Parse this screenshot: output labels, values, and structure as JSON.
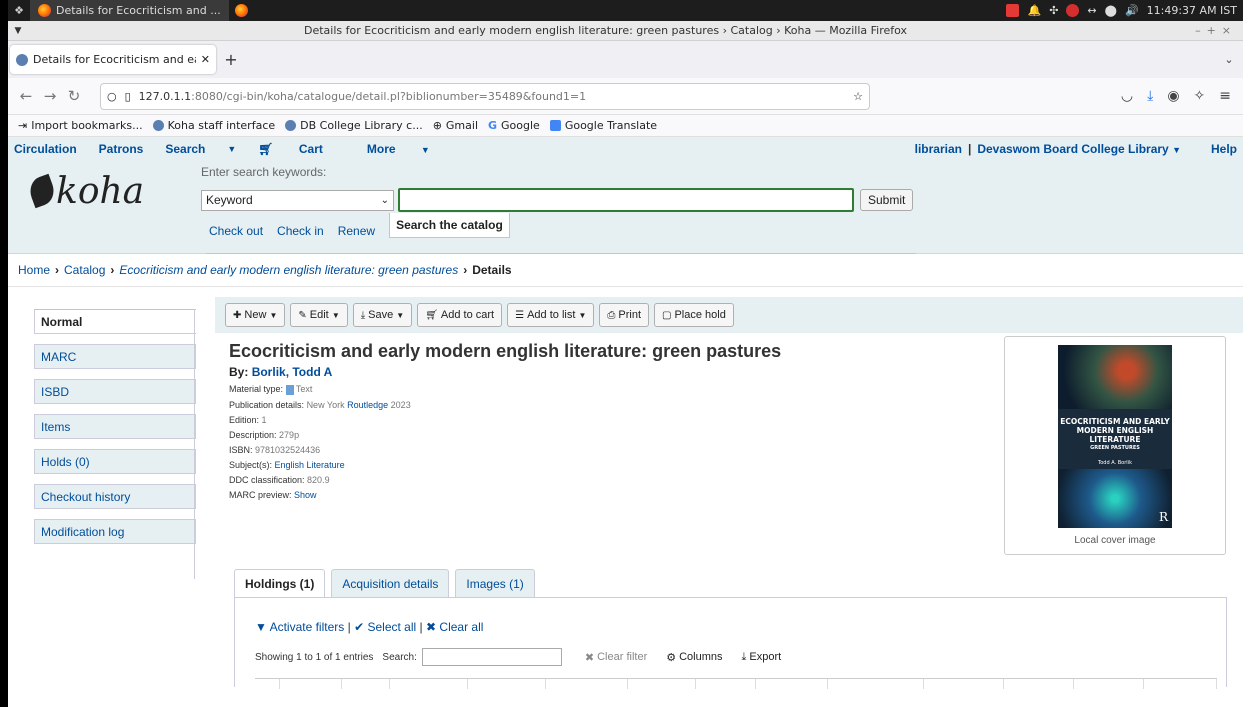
{
  "os": {
    "task_title": "Details for Ecocriticism and ...",
    "clock": "11:49:37 AM IST"
  },
  "window": {
    "title": "Details for Ecocriticism and early modern english literature: green pastures › Catalog › Koha — Mozilla Firefox"
  },
  "browser": {
    "tab_label": "Details for Ecocriticism and ea",
    "url_host": "127.0.1.1",
    "url_rest": ":8080/cgi-bin/koha/catalogue/detail.pl?biblionumber=35489&found1=1",
    "bookmarks": [
      "Import bookmarks...",
      "Koha staff interface",
      "DB College Library c...",
      "Gmail",
      "Google",
      "Google Translate"
    ]
  },
  "koha_nav": {
    "circulation": "Circulation",
    "patrons": "Patrons",
    "search": "Search",
    "cart": "Cart",
    "more": "More",
    "user": "librarian",
    "library": "Devaswom Board College Library",
    "help": "Help"
  },
  "logo": "koha",
  "search": {
    "hint": "Enter search keywords:",
    "type_selected": "Keyword",
    "query": "",
    "submit": "Submit",
    "tab_checkout": "Check out",
    "tab_checkin": "Check in",
    "tab_renew": "Renew",
    "tab_catalog": "Search the catalog"
  },
  "breadcrumb": {
    "home": "Home",
    "catalog": "Catalog",
    "record": "Ecocriticism and early modern english literature: green pastures",
    "current": "Details"
  },
  "sidebar": {
    "items": [
      "Normal",
      "MARC",
      "ISBD",
      "Items",
      "Holds (0)",
      "Checkout history",
      "Modification log"
    ]
  },
  "toolbar": {
    "new": "New",
    "edit": "Edit",
    "save": "Save",
    "add_cart": "Add to cart",
    "add_list": "Add to list",
    "print": "Print",
    "place_hold": "Place hold"
  },
  "record": {
    "title": "Ecocriticism and early modern english literature: green pastures",
    "by_label": "By:",
    "author": "Borlik, Todd A",
    "material_label": "Material type:",
    "material_value": "Text",
    "pub_label": "Publication details:",
    "pub_place": "New York",
    "publisher": "Routledge",
    "pub_year": "2023",
    "edition_label": "Edition:",
    "edition_value": "1",
    "desc_label": "Description:",
    "desc_value": "279p",
    "isbn_label": "ISBN:",
    "isbn_value": "9781032524436",
    "subject_label": "Subject(s):",
    "subject_value": "English Literature",
    "ddc_label": "DDC classification:",
    "ddc_value": "820.9",
    "marc_label": "MARC preview:",
    "marc_value": "Show"
  },
  "cover": {
    "line1": "ECOCRITICISM AND EARLY",
    "line2": "MODERN ENGLISH",
    "line3": "LITERATURE",
    "line4": "GREEN PASTURES",
    "author": "Todd A. Borlik",
    "caption": "Local cover image"
  },
  "lower_tabs": {
    "holdings": "Holdings (1)",
    "acquisition": "Acquisition details",
    "images": "Images (1)"
  },
  "holdings": {
    "activate_filters": "Activate filters",
    "select_all": "Select all",
    "clear_all": "Clear all",
    "showing": "Showing 1 to 1 of 1 entries",
    "search_label": "Search:",
    "clear_filter": "Clear filter",
    "columns": "Columns",
    "export": "Export"
  }
}
